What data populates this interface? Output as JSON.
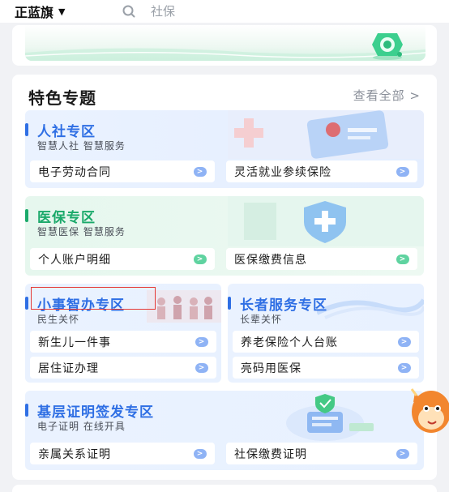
{
  "header": {
    "region": "正蓝旗",
    "search_placeholder": "社保"
  },
  "special": {
    "title": "特色专题",
    "view_all": "查看全部 >"
  },
  "zones": {
    "hr": {
      "title": "人社专区",
      "subtitle": "智慧人社 智慧服务",
      "items": [
        "电子劳动合同",
        "灵活就业参续保险"
      ]
    },
    "medical": {
      "title": "医保专区",
      "subtitle": "智慧医保 智慧服务",
      "items": [
        "个人账户明细",
        "医保缴费信息"
      ]
    },
    "small": {
      "title": "小事智办专区",
      "subtitle": "民生关怀",
      "items": [
        "新生儿一件事",
        "居住证办理"
      ]
    },
    "elder": {
      "title": "长者服务专区",
      "subtitle": "长辈关怀",
      "items": [
        "养老保险个人台账",
        "亮码用医保"
      ]
    },
    "certs": {
      "title": "基层证明签发专区",
      "subtitle": "电子证明 在线开具",
      "items": [
        "亲属关系证明",
        "社保缴费证明"
      ]
    }
  },
  "colors": {
    "blue_accent": "#2f6fe4",
    "green_accent": "#1aa96a",
    "arrow_blue": "#8fb3f5",
    "arrow_green": "#5fd3a0",
    "highlight": "#e53935"
  }
}
